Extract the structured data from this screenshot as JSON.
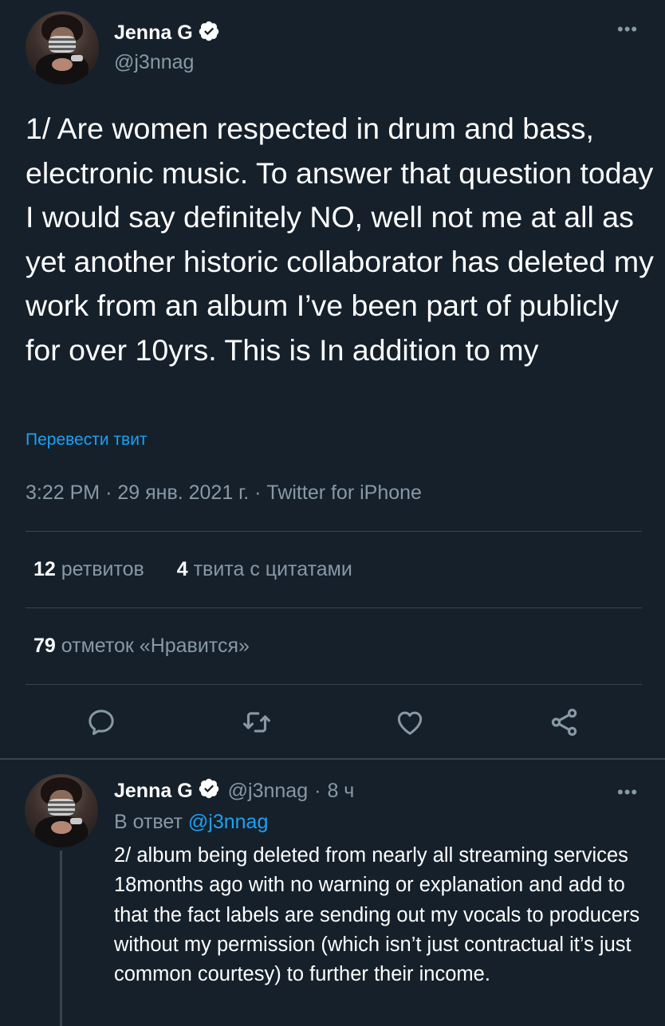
{
  "main_tweet": {
    "author_name": "Jenna G",
    "author_handle": "@j3nnag",
    "text": "1/ Are women respected in drum and bass, electronic music. To answer that question today I would say definitely NO, well not me at all as yet another historic collaborator has deleted my work  from an album I’ve been part of publicly for over 10yrs. This is In addition to my",
    "translate_label": "Перевести твит",
    "time": "3:22 PM",
    "date": "29 янв. 2021 г.",
    "source": "Twitter for iPhone",
    "separator": "·",
    "retweets_count": "12",
    "retweets_label": "ретвитов",
    "quotes_count": "4",
    "quotes_label": "твита с цитатами",
    "likes_count": "79",
    "likes_label": "отметок «Нравится»"
  },
  "actions": [
    {
      "name": "reply",
      "icon": "reply-icon"
    },
    {
      "name": "retweet",
      "icon": "retweet-icon"
    },
    {
      "name": "like",
      "icon": "heart-icon"
    },
    {
      "name": "share",
      "icon": "share-icon"
    }
  ],
  "reply_tweet": {
    "author_name": "Jenna G",
    "author_handle": "@j3nnag",
    "separator": "·",
    "age": "8 ч",
    "reply_prefix": "В ответ",
    "reply_mention": "@j3nnag",
    "text": "2/ album being deleted from nearly all streaming services 18months ago with no warning or explanation and add to that the fact labels are sending out my vocals to producers without my permission (which isn’t just contractual it’s just common courtesy) to further their income."
  },
  "colors": {
    "background": "#15202b",
    "text": "#ffffff",
    "secondary": "#8899a6",
    "accent": "#1da1f2",
    "divider": "#38444d"
  }
}
